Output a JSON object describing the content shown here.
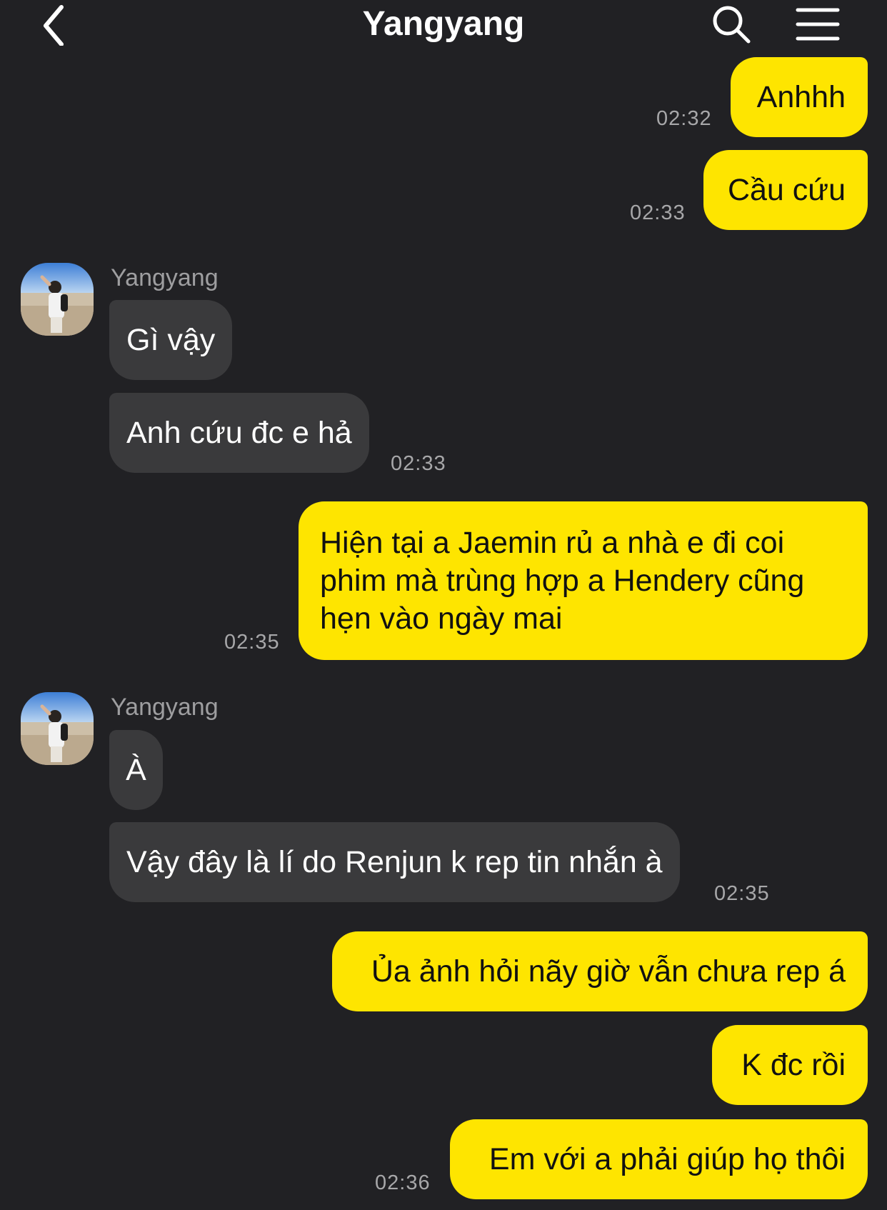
{
  "header": {
    "title": "Yangyang"
  },
  "messages": {
    "m1": {
      "text": "Anhhh",
      "time": "02:32"
    },
    "m2": {
      "text": "Cầu cứu",
      "time": "02:33"
    },
    "g1": {
      "sender": "Yangyang"
    },
    "m3": {
      "text": "Gì vậy"
    },
    "m4": {
      "text": "Anh cứu đc e hả",
      "time": "02:33"
    },
    "m5": {
      "text": "Hiện tại a Jaemin rủ a nhà e đi coi phim mà trùng hợp a Hendery cũng hẹn vào ngày mai",
      "time": "02:35"
    },
    "g2": {
      "sender": "Yangyang"
    },
    "m6": {
      "text": "À"
    },
    "m7": {
      "text": "Vậy đây là lí do Renjun k rep tin nhắn à",
      "time": "02:35"
    },
    "m8": {
      "text": "Ủa ảnh hỏi nãy giờ vẫn chưa rep á"
    },
    "m9": {
      "text": "K đc rồi"
    },
    "m10": {
      "text": "Em với a phải giúp họ thôi",
      "time": "02:36"
    }
  },
  "colors": {
    "background": "#212124",
    "outgoing_bubble": "#FEE500",
    "incoming_bubble": "#3A3A3C",
    "timestamp": "#A7A7A9"
  },
  "icons": [
    "back-chevron-icon",
    "search-icon",
    "menu-icon",
    "avatar-photo"
  ]
}
